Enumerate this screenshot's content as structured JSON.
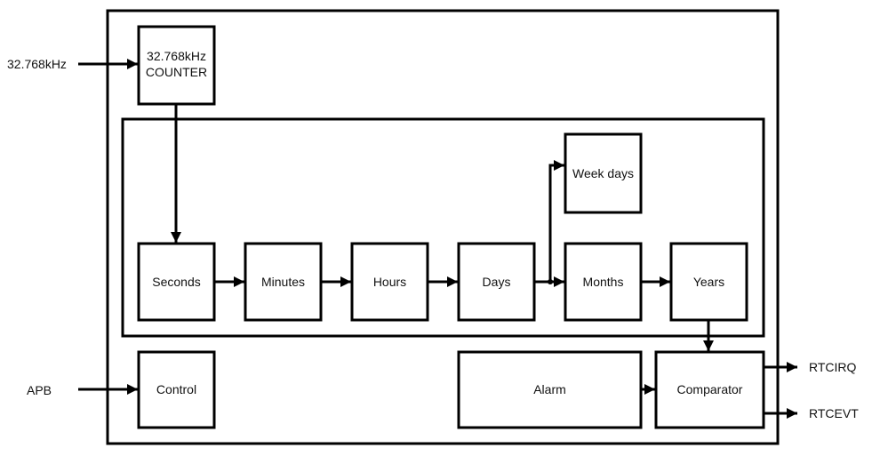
{
  "inputs": {
    "clock": "32.768kHz",
    "bus": "APB"
  },
  "outputs": {
    "irq": "RTCIRQ",
    "evt": "RTCEVT"
  },
  "blocks": {
    "counter_line1": "32.768kHz",
    "counter_line2": "COUNTER",
    "seconds": "Seconds",
    "minutes": "Minutes",
    "hours": "Hours",
    "days": "Days",
    "months": "Months",
    "years": "Years",
    "week_days": "Week days",
    "control": "Control",
    "alarm": "Alarm",
    "comparator": "Comparator"
  }
}
